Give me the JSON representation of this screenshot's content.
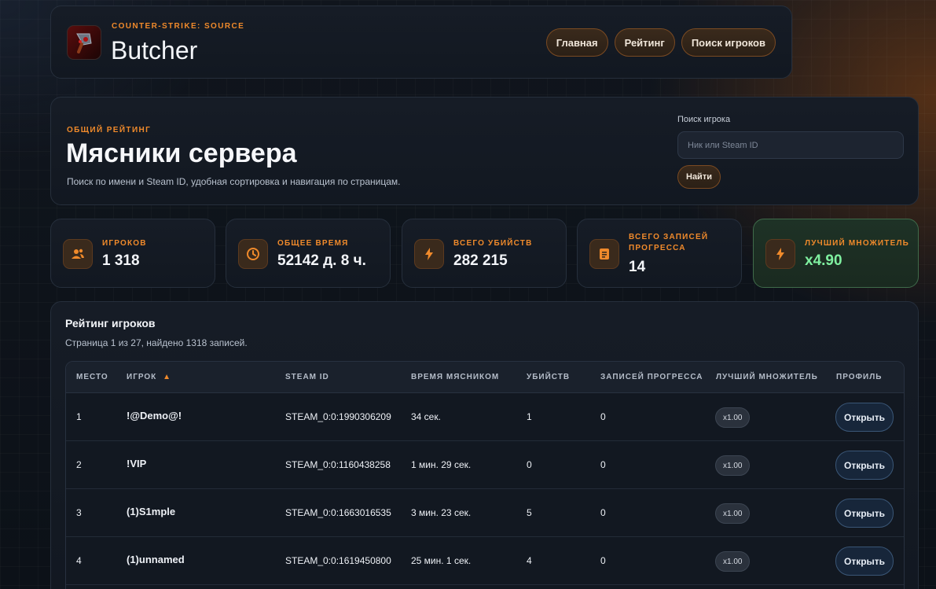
{
  "header": {
    "game_label": "COUNTER-STRIKE: SOURCE",
    "brand": "Butcher",
    "nav": [
      "Главная",
      "Рейтинг",
      "Поиск игроков"
    ]
  },
  "hero": {
    "eyebrow": "ОБЩИЙ РЕЙТИНГ",
    "title": "Мясники сервера",
    "description": "Поиск по имени и Steam ID, удобная сортировка и навигация по страницам.",
    "search_label": "Поиск игрока",
    "search_placeholder": "Ник или Steam ID",
    "search_value": "",
    "search_button": "Найти"
  },
  "stats": [
    {
      "label": "ИГРОКОВ",
      "value": "1 318",
      "icon": "users-icon"
    },
    {
      "label": "ОБЩЕЕ ВРЕМЯ",
      "value": "52142 д. 8 ч.",
      "icon": "clock-icon"
    },
    {
      "label": "ВСЕГО УБИЙСТВ",
      "value": "282 215",
      "icon": "bolt-icon"
    },
    {
      "label": "ВСЕГО ЗАПИСЕЙ ПРОГРЕССА",
      "value": "14",
      "icon": "document-icon"
    },
    {
      "label": "ЛУЧШИЙ МНОЖИТЕЛЬ",
      "value": "x4.90",
      "icon": "bolt-icon"
    }
  ],
  "table": {
    "title": "Рейтинг игроков",
    "subtitle": "Страница 1 из 27, найдено 1318 записей.",
    "columns": [
      "МЕСТО",
      "ИГРОК",
      "STEAM ID",
      "ВРЕМЯ МЯСНИКОМ",
      "УБИЙСТВ",
      "ЗАПИСЕЙ ПРОГРЕССА",
      "ЛУЧШИЙ МНОЖИТЕЛЬ",
      "ПРОФИЛЬ"
    ],
    "sort_indicator": "▲",
    "rows": [
      {
        "place": "1",
        "player": "!@Demo@!",
        "steam_id": "STEAM_0:0:1990306209",
        "time": "34 сек.",
        "kills": "1",
        "progress": "0",
        "multiplier": "x1.00",
        "action": "Открыть"
      },
      {
        "place": "2",
        "player": "!VIP",
        "steam_id": "STEAM_0:0:1160438258",
        "time": "1 мин. 29 сек.",
        "kills": "0",
        "progress": "0",
        "multiplier": "x1.00",
        "action": "Открыть"
      },
      {
        "place": "3",
        "player": "(1)S1mple",
        "steam_id": "STEAM_0:0:1663016535",
        "time": "3 мин. 23 сек.",
        "kills": "5",
        "progress": "0",
        "multiplier": "x1.00",
        "action": "Открыть"
      },
      {
        "place": "4",
        "player": "(1)unnamed",
        "steam_id": "STEAM_0:0:1619450800",
        "time": "25 мин. 1 сек.",
        "kills": "4",
        "progress": "0",
        "multiplier": "x1.00",
        "action": "Открыть"
      }
    ]
  },
  "colors": {
    "accent": "#f08a2b",
    "success": "#7ff0a0",
    "background": "#0f141b"
  }
}
